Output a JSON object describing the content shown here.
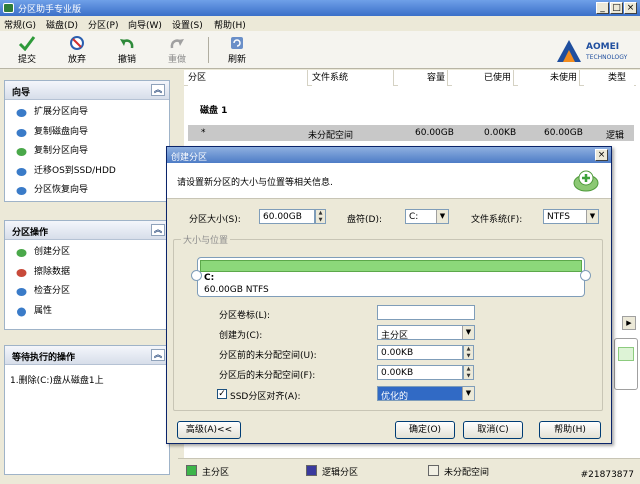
{
  "window": {
    "title": "分区助手专业版",
    "min": "_",
    "max": "□",
    "close": "×"
  },
  "menu": [
    "常规(G)",
    "磁盘(D)",
    "分区(P)",
    "向导(W)",
    "设置(S)",
    "帮助(H)"
  ],
  "toolbar": {
    "commit": "提交",
    "discard": "放弃",
    "undo": "撤销",
    "redo": "重做",
    "refresh": "刷新"
  },
  "logo": {
    "line1": "AOMEI",
    "line2": "TECHNOLOGY"
  },
  "left": {
    "wizard": {
      "title": "向导",
      "items": [
        "扩展分区向导",
        "复制磁盘向导",
        "复制分区向导",
        "迁移OS到SSD/HDD",
        "分区恢复向导"
      ]
    },
    "ops": {
      "title": "分区操作",
      "items": [
        "创建分区",
        "擦除数据",
        "检查分区",
        "属性"
      ]
    },
    "pending": {
      "title": "等待执行的操作",
      "items": [
        "1.删除(C:)盘从磁盘1上"
      ]
    }
  },
  "table": {
    "headers": [
      "分区",
      "文件系统",
      "容量",
      "已使用",
      "未使用",
      "类型"
    ],
    "disk_label": "磁盘 1",
    "row": {
      "partition": "*",
      "fs": "未分配空间",
      "capacity": "60.00GB",
      "used": "0.00KB",
      "unused": "60.00GB",
      "type": "逻辑"
    }
  },
  "legend": {
    "primary": "主分区",
    "logical": "逻辑分区",
    "unallocated": "未分配空间",
    "primary_color": "#3DB54A",
    "logical_color": "#3A3A9E",
    "unalloc_color": "#F2F0E4"
  },
  "watermark": "#21873877",
  "dialog": {
    "title": "创建分区",
    "close": "×",
    "description": "请设置新分区的大小与位置等相关信息.",
    "size_label": "分区大小(S):",
    "size_value": "60.00GB",
    "drive_label": "盘符(D):",
    "drive_value": "C:",
    "fs_label": "文件系统(F):",
    "fs_value": "NTFS",
    "group_label": "大小与位置",
    "part_name": "C:",
    "part_info": "60.00GB NTFS",
    "volume_label_label": "分区卷标(L):",
    "volume_label_value": "",
    "create_as_label": "创建为(C):",
    "create_as_value": "主分区",
    "before_label": "分区前的未分配空间(U):",
    "before_value": "0.00KB",
    "after_label": "分区后的未分配空间(F):",
    "after_value": "0.00KB",
    "ssd_label": "SSD分区对齐(A):",
    "ssd_checked": "✓",
    "ssd_value": "优化的",
    "btn_advanced": "高级(A)<<",
    "btn_ok": "确定(O)",
    "btn_cancel": "取消(C)",
    "btn_help": "帮助(H)"
  }
}
